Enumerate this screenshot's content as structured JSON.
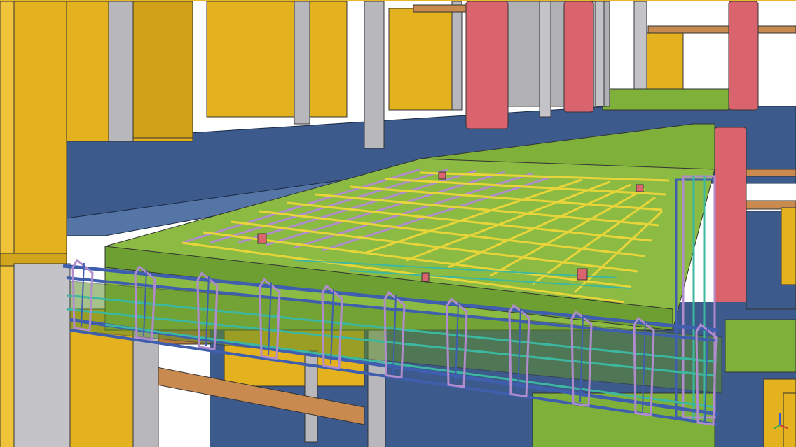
{
  "viewer": {
    "title": "",
    "background": "#ffffff",
    "frame_color": "#e8b82a"
  },
  "scene": {
    "description_free": true,
    "materials": {
      "floor_slab": "#3d5a8c",
      "yellow_wall": "#e3b21e",
      "yellow_wall_dark": "#c99a14",
      "grey_column": "#b8b8bc",
      "red_column": "#d9646e",
      "green_formwork": "#7fb03a",
      "green_formwork_dark": "#5f8f2a",
      "rebar_blue": "#3f5fae",
      "rebar_purple": "#b08ccc",
      "rebar_teal": "#3cb8a0",
      "rebar_yellow": "#e8d53a",
      "timber": "#c88a4e",
      "sky": "#ffffff"
    },
    "rebar_ties_count": 11
  },
  "axis_indicator": {
    "icon": "axis-triad-icon",
    "colors": [
      "#d23b3b",
      "#3bb04a",
      "#3b5fd2"
    ]
  }
}
